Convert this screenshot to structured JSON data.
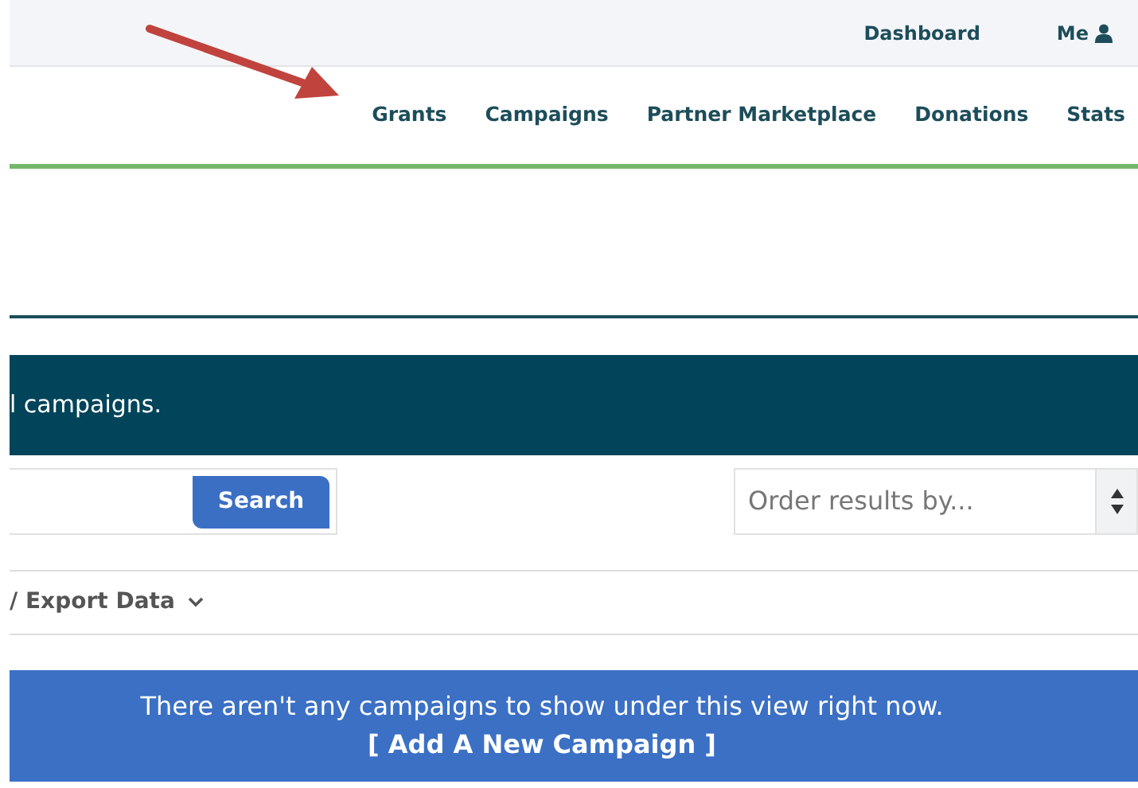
{
  "top_links": [
    {
      "label": "Dashboard",
      "icon": false
    },
    {
      "label": "Me",
      "icon": true
    }
  ],
  "main_nav": [
    {
      "label": "Grants"
    },
    {
      "label": "Campaigns"
    },
    {
      "label": "Partner Marketplace"
    },
    {
      "label": "Donations"
    },
    {
      "label": "Stats"
    }
  ],
  "banner": {
    "text": "l campaigns."
  },
  "search": {
    "button": "Search"
  },
  "order_select": {
    "placeholder": "Order results by..."
  },
  "export": {
    "label": "/ Export Data"
  },
  "empty_alert": {
    "message": "There aren't any campaigns to show under this view right now.",
    "link": "[ Add A New Campaign ]"
  }
}
